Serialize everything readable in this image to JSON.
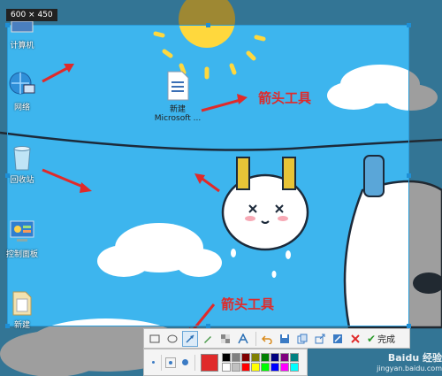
{
  "selection": {
    "size_label": "600 × 450"
  },
  "desktop_icons": [
    {
      "label": "计算机",
      "icon": "computer-icon"
    },
    {
      "label": "网络",
      "icon": "network-globe-icon"
    },
    {
      "label": "回收站",
      "icon": "recycle-bin-icon"
    },
    {
      "label": "控制面板",
      "icon": "control-panel-icon"
    },
    {
      "label": "新建",
      "icon": "folder-icon"
    }
  ],
  "file_icon": {
    "line1": "新建",
    "line2": "Microsoft ...",
    "icon": "word-document-icon"
  },
  "annotations": {
    "arrow_tool_top": "箭头工具",
    "arrow_tool_bottom": "箭头工具"
  },
  "toolbar": {
    "tools": [
      "rectangle-icon",
      "ellipse-icon",
      "arrow-icon",
      "brush-icon",
      "mosaic-icon",
      "text-icon",
      "undo-icon",
      "save-icon",
      "copy-icon",
      "share-icon",
      "pin-icon",
      "cancel-icon"
    ],
    "done_label": "完成",
    "active_tool": "arrow-icon"
  },
  "palette": {
    "current_color": "#e02a2a",
    "swatches": [
      "#000000",
      "#808080",
      "#800000",
      "#808000",
      "#008000",
      "#000080",
      "#800080",
      "#008080",
      "#ffffff",
      "#c0c0c0",
      "#ff0000",
      "#ffff00",
      "#00ff00",
      "#0000ff",
      "#ff00ff",
      "#00ffff"
    ]
  },
  "watermark": {
    "line1": "Baidu 经验",
    "line2": "jingyan.baidu.com"
  },
  "colors": {
    "sky": "#3db5ee",
    "annotation_red": "#e02a2a",
    "selection_border": "#2a9bd8"
  }
}
